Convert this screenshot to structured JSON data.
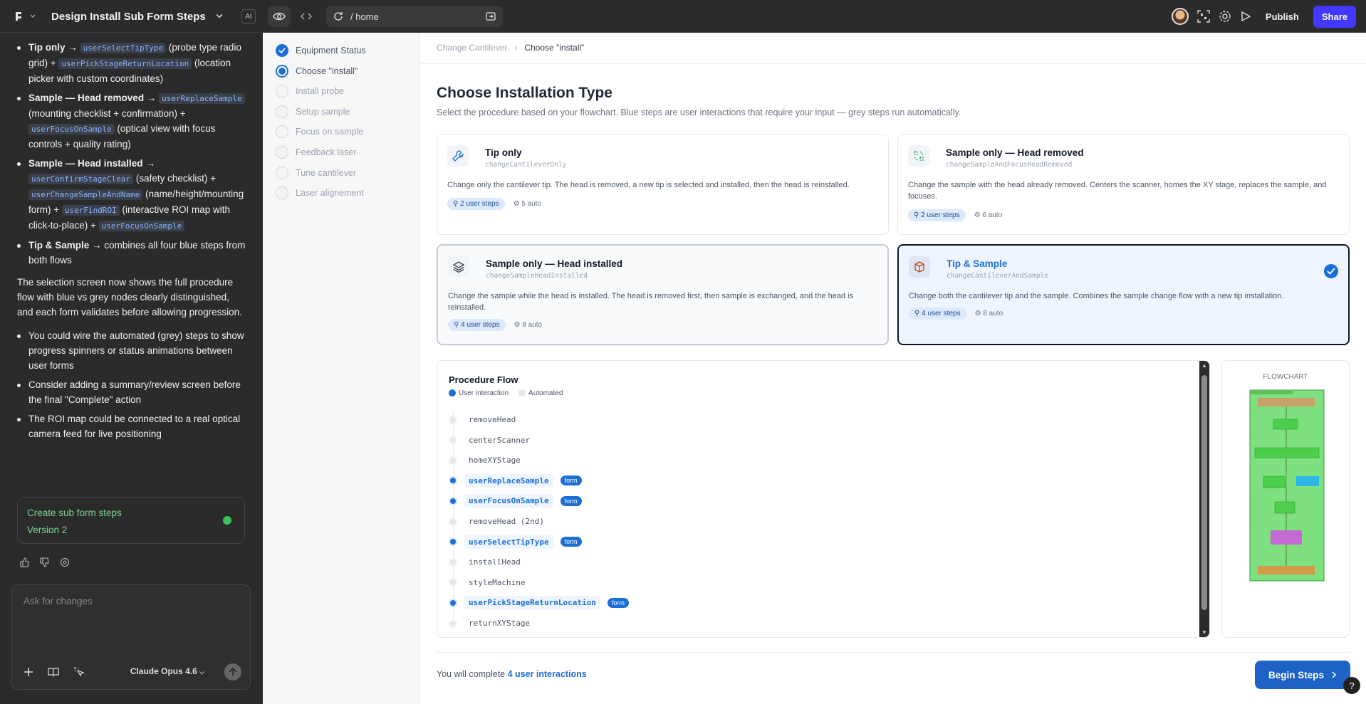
{
  "topbar": {
    "project_title": "Design Install Sub Form Steps",
    "ai_badge": "AI",
    "url": "/ home",
    "publish_label": "Publish",
    "share_label": "Share"
  },
  "chat": {
    "bullets1": [
      {
        "lead": "Tip only",
        "arrow": "→",
        "parts": [
          {
            "code": "userSelectTipType"
          },
          {
            "text": " (probe type radio grid) + "
          },
          {
            "code": "userPickStageReturnLocation"
          },
          {
            "text": " (location picker with custom coordinates)"
          }
        ]
      },
      {
        "lead": "Sample — Head removed",
        "arrow": "→",
        "parts": [
          {
            "code": "userReplaceSample"
          },
          {
            "text": " (mounting checklist + confirmation) + "
          },
          {
            "code": "userFocusOnSample"
          },
          {
            "text": " (optical view with focus controls + quality rating)"
          }
        ]
      },
      {
        "lead": "Sample — Head installed",
        "arrow": "→",
        "parts": [
          {
            "code": "userConfirmStageClear"
          },
          {
            "text": " (safety checklist) + "
          },
          {
            "code": "userChangeSampleAndName"
          },
          {
            "text": " (name/height/mounting form) + "
          },
          {
            "code": "userFindROI"
          },
          {
            "text": " (interactive ROI map with click-to-place) + "
          },
          {
            "code": "userFocusOnSample"
          }
        ]
      },
      {
        "lead": "Tip & Sample",
        "arrow": "→",
        "parts": [
          {
            "text": " combines all four blue steps from both flows"
          }
        ]
      }
    ],
    "paragraph": "The selection screen now shows the full procedure flow with blue vs grey nodes clearly distinguished, and each form validates before allowing progression.",
    "bullets2": [
      "You could wire the automated (grey) steps to show progress spinners or status animations between user forms",
      "Consider adding a summary/review screen before the final \"Complete\" action",
      "The ROI map could be connected to a real optical camera feed for live positioning"
    ],
    "version_title": "Create sub form steps",
    "version_label": "Version 2",
    "input_placeholder": "Ask for changes",
    "model_label": "Claude Opus 4.6"
  },
  "steps": [
    {
      "label": "Equipment Status",
      "state": "done"
    },
    {
      "label": "Choose \"install\"",
      "state": "active"
    },
    {
      "label": "Install probe",
      "state": "todo"
    },
    {
      "label": "Setup sample",
      "state": "todo"
    },
    {
      "label": "Focus on sample",
      "state": "todo"
    },
    {
      "label": "Feedback laser",
      "state": "todo"
    },
    {
      "label": "Tune cantilever",
      "state": "todo"
    },
    {
      "label": "Laser alignement",
      "state": "todo"
    }
  ],
  "breadcrumb": {
    "parent": "Change Cantilever",
    "current": "Choose \"install\""
  },
  "heading": "Choose Installation Type",
  "subheading": "Select the procedure based on your flowchart. Blue steps are user interactions that require your input — grey steps run automatically.",
  "cards": [
    {
      "title": "Tip only",
      "id": "changeCantileverOnly",
      "desc": "Change only the cantilever tip. The head is removed, a new tip is selected and installed, then the head is reinstalled.",
      "user_steps": "2 user steps",
      "auto": "5 auto",
      "icon": "wrench-icon"
    },
    {
      "title": "Sample only — Head removed",
      "id": "changeSampleAndFocusHeadRemoved",
      "desc": "Change the sample with the head already removed. Centers the scanner, homes the XY stage, replaces the sample, and focuses.",
      "user_steps": "2 user steps",
      "auto": "6 auto",
      "icon": "swap-icon"
    },
    {
      "title": "Sample only — Head installed",
      "id": "changeSampleHeadInstalled",
      "desc": "Change the sample while the head is installed. The head is removed first, then sample is exchanged, and the head is reinstalled.",
      "user_steps": "4 user steps",
      "auto": "8 auto",
      "icon": "layers-icon"
    },
    {
      "title": "Tip & Sample",
      "id": "changeCantileverAndSample",
      "desc": "Change both the cantilever tip and the sample. Combines the sample change flow with a new tip installation.",
      "user_steps": "4 user steps",
      "auto": "8 auto",
      "icon": "box-icon"
    }
  ],
  "flow": {
    "title": "Procedure Flow",
    "legend_user": "User interaction",
    "legend_auto": "Automated",
    "form_label": "form",
    "nodes": [
      {
        "name": "removeHead",
        "user": false
      },
      {
        "name": "centerScanner",
        "user": false
      },
      {
        "name": "homeXYStage",
        "user": false
      },
      {
        "name": "userReplaceSample",
        "user": true
      },
      {
        "name": "userFocusOnSample",
        "user": true
      },
      {
        "name": "removeHead (2nd)",
        "user": false
      },
      {
        "name": "userSelectTipType",
        "user": true
      },
      {
        "name": "installHead",
        "user": false
      },
      {
        "name": "styleMachine",
        "user": false
      },
      {
        "name": "userPickStageReturnLocation",
        "user": true
      },
      {
        "name": "returnXYStage",
        "user": false
      }
    ]
  },
  "flowchart_label": "FLOWCHART",
  "footer": {
    "prefix": "You will complete",
    "count": "4 user interactions",
    "begin_label": "Begin Steps",
    "help": "?"
  },
  "colors": {
    "accent": "#1d6fd6",
    "share": "#4338ff",
    "flowchart_green": "#7ee07e"
  }
}
